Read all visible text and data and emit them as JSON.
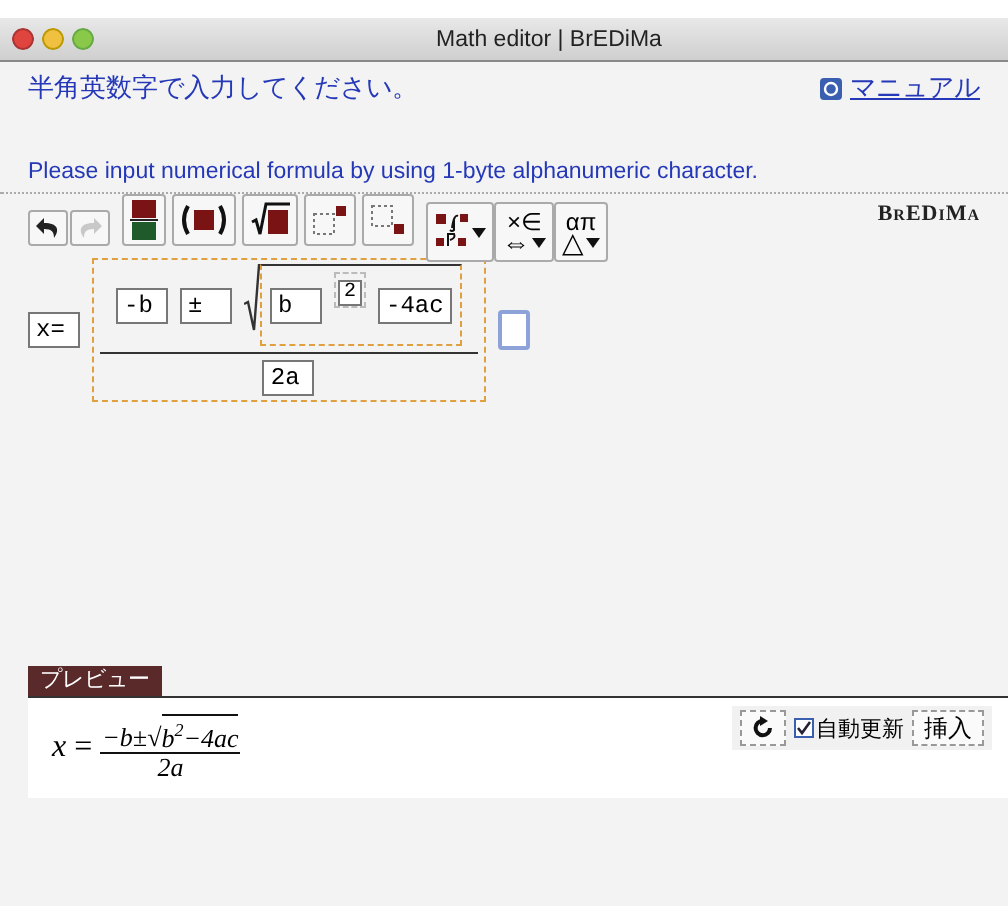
{
  "window": {
    "title": "Math editor | BrEDiMa"
  },
  "instruction_ja": "半角英数字で入力してください。",
  "manual_link": {
    "label": "マニュアル"
  },
  "instruction_en": "Please input numerical formula by using 1-byte alphanumeric character.",
  "toolbar": {
    "buttons": [
      {
        "kind": "undo",
        "disabled": false
      },
      {
        "kind": "redo",
        "disabled": true
      },
      {
        "kind": "fraction"
      },
      {
        "kind": "parentheses"
      },
      {
        "kind": "sqrt"
      },
      {
        "kind": "superscript"
      },
      {
        "kind": "subscript"
      },
      {
        "kind": "script-menu"
      },
      {
        "kind": "symbol-menu",
        "top": "×∈",
        "bottom": "⇔"
      },
      {
        "kind": "symbol-menu",
        "top": "απ",
        "bottom": "△"
      }
    ],
    "logo": "BrEDiMa"
  },
  "editor": {
    "lhs": "x=",
    "numerator": {
      "first": "-b",
      "operator": "±",
      "root": {
        "base": "b",
        "exponent": "2",
        "rest": "-4ac"
      }
    },
    "denominator": "2a"
  },
  "preview": {
    "label": "プレビュー",
    "lhs": "x",
    "equals": "=",
    "numerator": "−b±",
    "root_sign": "√",
    "radicand": "b$^{2}$−4ac",
    "denominator": "2a",
    "auto_update": {
      "label": "自動更新",
      "checked": true
    },
    "insert_button": "挿入"
  }
}
